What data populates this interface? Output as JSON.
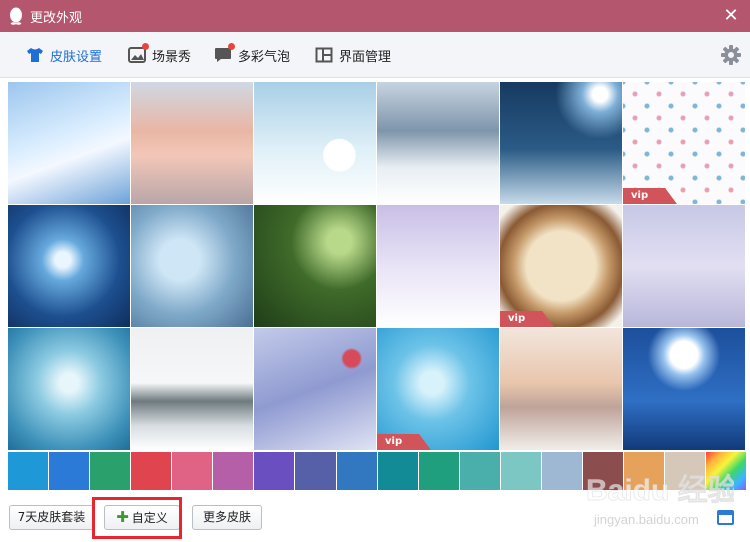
{
  "window": {
    "title": "更改外观"
  },
  "tabs": [
    {
      "label": "皮肤设置",
      "active": true
    },
    {
      "label": "场景秀",
      "badge": true
    },
    {
      "label": "多彩气泡",
      "badge": true
    },
    {
      "label": "界面管理"
    }
  ],
  "vip_label": "vip",
  "skins": [
    {
      "name": "sky-clouds",
      "vip": false
    },
    {
      "name": "town-street",
      "vip": false
    },
    {
      "name": "snowman",
      "vip": false
    },
    {
      "name": "snowy-forest",
      "vip": false
    },
    {
      "name": "night-lamp",
      "vip": false
    },
    {
      "name": "pattern",
      "vip": true
    },
    {
      "name": "snowflake",
      "vip": false
    },
    {
      "name": "merry-christmas",
      "vip": false
    },
    {
      "name": "pine-branch",
      "vip": false
    },
    {
      "name": "winter-couple",
      "vip": false
    },
    {
      "name": "coffee-art",
      "vip": true
    },
    {
      "name": "snowy-trees",
      "vip": false
    },
    {
      "name": "frozen-branch",
      "vip": false
    },
    {
      "name": "winter-lake",
      "vip": false
    },
    {
      "name": "winter-bird",
      "vip": false
    },
    {
      "name": "feather",
      "vip": true
    },
    {
      "name": "snow-bridge",
      "vip": false
    },
    {
      "name": "christmas-night",
      "vip": false
    }
  ],
  "swatches": [
    "#1e98d7",
    "#2b7ad8",
    "#2aa06c",
    "#e0454f",
    "#e06385",
    "#b55fa8",
    "#6a4fc0",
    "#5660a8",
    "#3178c0",
    "#138b96",
    "#1f9f7e",
    "#4aafaa",
    "#7cc7c3",
    "#9eb8d3",
    "#8b4d4d",
    "#e6a25a",
    "#d6c8b8",
    "rainbow"
  ],
  "bottom": {
    "btn_skin_pack": "7天皮肤套装",
    "btn_custom": "自定义",
    "btn_more": "更多皮肤"
  },
  "watermark": {
    "brand": "Baidu 经验",
    "url": "jingyan.baidu.com"
  }
}
